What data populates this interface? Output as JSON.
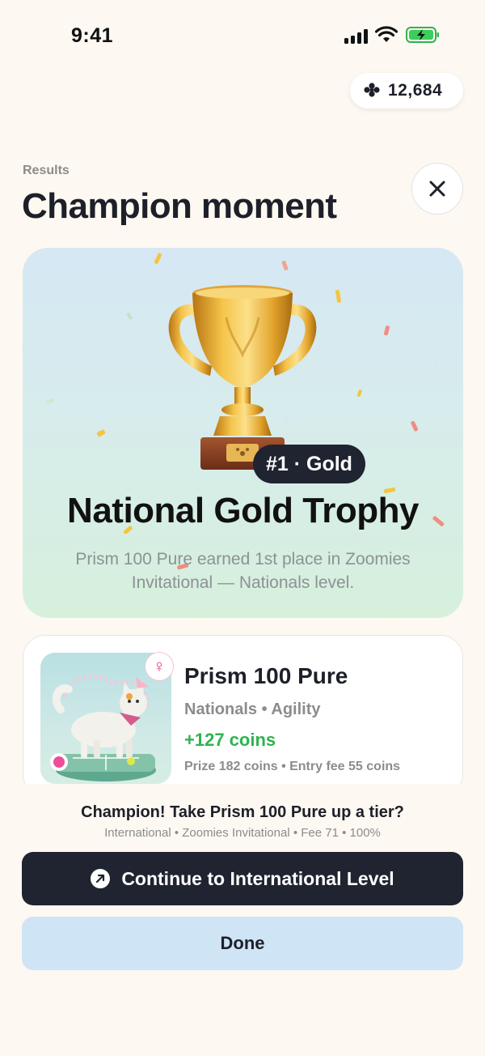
{
  "status_bar": {
    "time": "9:41"
  },
  "wallet": {
    "coins": "12,684",
    "icon": "paw-coin-icon"
  },
  "header": {
    "eyebrow": "Results",
    "title": "Champion moment"
  },
  "hero": {
    "trophy_icon": "gold-trophy-icon",
    "rank_badge": "#1 · Gold",
    "title": "National Gold Trophy",
    "subtitle": "Prism 100 Pure earned 1st place in Zoomies Invitational — Nationals level."
  },
  "pet_card": {
    "name": "Prism 100 Pure",
    "gender_symbol": "♀",
    "meta": "Nationals • Agility",
    "coins_change": "+127 coins",
    "fees": "Prize 182 coins • Entry fee 55 coins"
  },
  "promo": {
    "title": "Champion! Take Prism 100 Pure up a tier?",
    "meta": "International • Zoomies Invitational • Fee 71 • 100%"
  },
  "actions": {
    "continue_label": "Continue to International Level",
    "done_label": "Done"
  },
  "colors": {
    "background": "#fdf8f1",
    "primary_dark": "#1f2430",
    "success_green": "#2fb34f",
    "done_blue": "#cfe4f4"
  }
}
